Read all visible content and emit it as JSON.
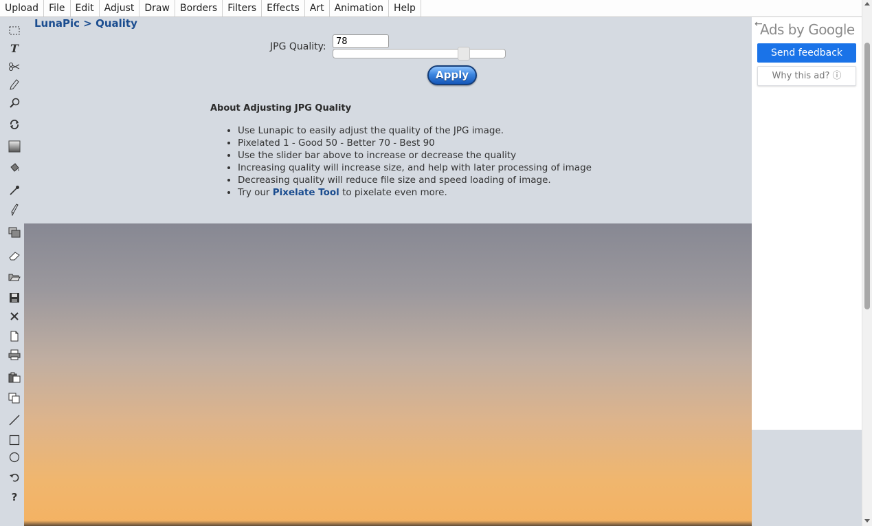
{
  "menu": [
    "Upload",
    "File",
    "Edit",
    "Adjust",
    "Draw",
    "Borders",
    "Filters",
    "Effects",
    "Art",
    "Animation",
    "Help"
  ],
  "breadcrumb": "LunaPic > Quality",
  "quality": {
    "label": "JPG Quality:",
    "value": "78",
    "slider_fraction": 0.78,
    "apply_label": "Apply"
  },
  "about": {
    "heading": "About Adjusting JPG Quality",
    "items": [
      "Use Lunapic to easily adjust the quality of the JPG image.",
      "Pixelated 1 - Good 50 - Better 70 - Best 90",
      "Use the slider bar above to increase or decrease the quality",
      "Increasing quality will increase size, and help with later processing of image",
      "Decreasing quality will reduce file size and speed loading of image."
    ],
    "last_item": {
      "prefix": "Try our ",
      "link": "Pixelate Tool",
      "suffix": " to pixelate even more."
    }
  },
  "ads": {
    "label": "Ads by Google",
    "send_feedback": "Send feedback",
    "why_ad": "Why this ad? ⓘ",
    "back_arrow": "←"
  },
  "tools": [
    "select-rectangle-icon",
    "text-icon",
    "scissors-icon",
    "pencil-icon",
    "zoom-icon",
    "rotate-icon",
    "gradient-icon",
    "paint-bucket-icon",
    "eyedropper-icon",
    "brush-icon",
    "layers-icon",
    "eraser-icon",
    "open-folder-icon",
    "save-icon",
    "close-icon",
    "new-page-icon",
    "print-icon",
    "paste-icon",
    "copy-icon",
    "line-icon",
    "rectangle-icon",
    "circle-icon",
    "undo-icon",
    "help-icon"
  ],
  "help_glyph": "?"
}
